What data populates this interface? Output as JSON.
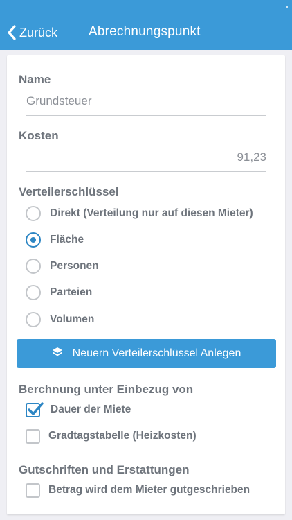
{
  "navbar": {
    "back_label": "Zurück",
    "title": "Abrechnungspunkt"
  },
  "form": {
    "name": {
      "label": "Name",
      "value": "Grundsteuer"
    },
    "kosten": {
      "label": "Kosten",
      "value": "91,23"
    },
    "verteilerschluessel": {
      "label": "Verteilerschlüssel",
      "options": [
        {
          "label": "Direkt (Verteilung nur auf diesen Mieter)",
          "selected": false
        },
        {
          "label": "Fläche",
          "selected": true
        },
        {
          "label": "Personen",
          "selected": false
        },
        {
          "label": "Parteien",
          "selected": false
        },
        {
          "label": "Volumen",
          "selected": false
        }
      ],
      "add_button_label": "Neuern Verteilerschlüssel Anlegen"
    },
    "berechnung": {
      "label": "Berchnung unter Einbezug von",
      "options": [
        {
          "label": "Dauer der Miete",
          "checked": true
        },
        {
          "label": "Gradtagstabelle (Heizkosten)",
          "checked": false
        }
      ]
    },
    "gutschriften": {
      "label": "Gutschriften und Erstattungen",
      "options": [
        {
          "label": "Betrag wird dem Mieter gutgeschrieben",
          "checked": false
        }
      ]
    }
  },
  "icons": {
    "back": "chevron-left-icon",
    "add_button": "layers-icon"
  },
  "colors": {
    "navbar": "#3b9ad8",
    "accent": "#2d86c4",
    "background": "#efeff4",
    "label": "#6e747c"
  }
}
